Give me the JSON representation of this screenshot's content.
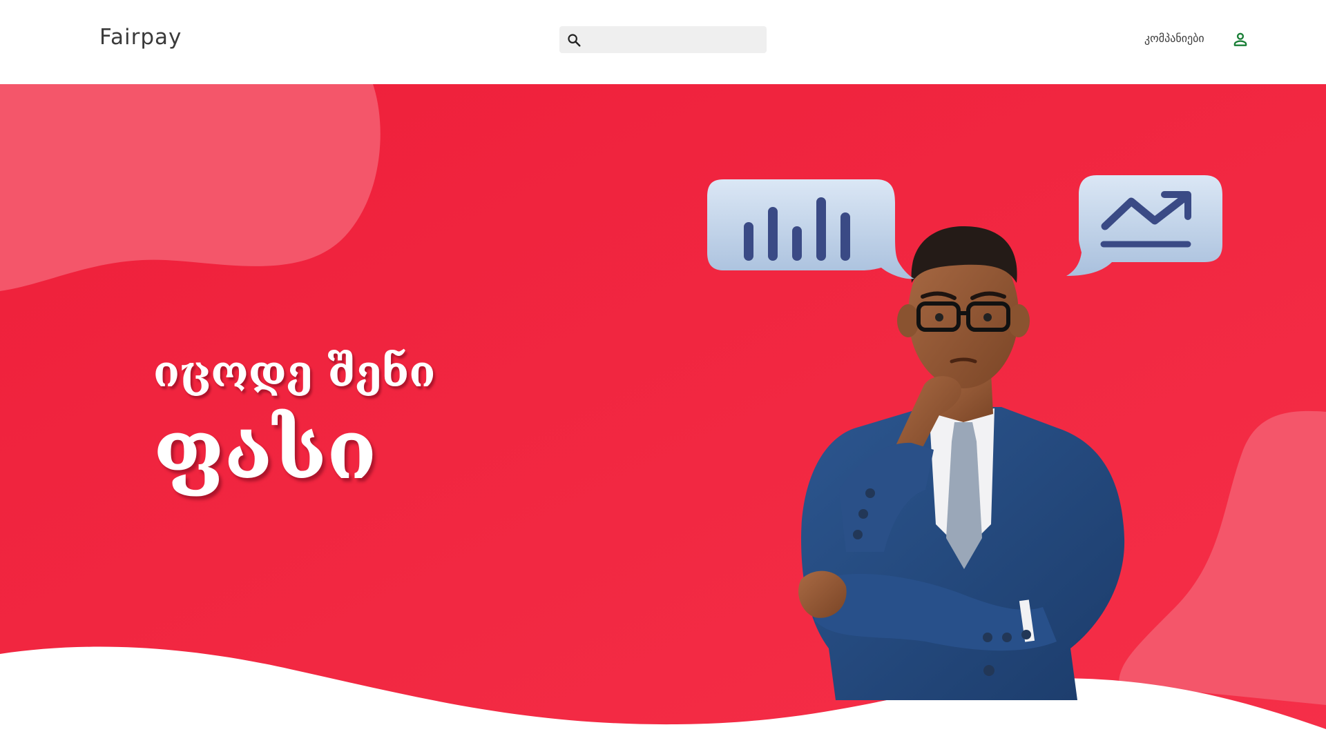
{
  "header": {
    "logo": "Fairpay",
    "search": {
      "placeholder": "",
      "icon": "search-icon"
    },
    "nav": {
      "companies_label": "კომპანიები",
      "user_icon": "user-icon"
    }
  },
  "hero": {
    "title_line1": "იცოდე შენი",
    "title_line2": "ფასი",
    "illustration": "thinking-businessman",
    "bubble_left_icon": "bar-chart-icon",
    "bubble_right_icon": "trending-up-icon"
  },
  "colors": {
    "hero_red": "#f0253e",
    "blob_light": "#f4566a",
    "accent_green": "#1a7f37",
    "text_dark": "#3a3a3a",
    "bubble_blue": "#c8d9ee",
    "icon_navy": "#3a4a85"
  }
}
